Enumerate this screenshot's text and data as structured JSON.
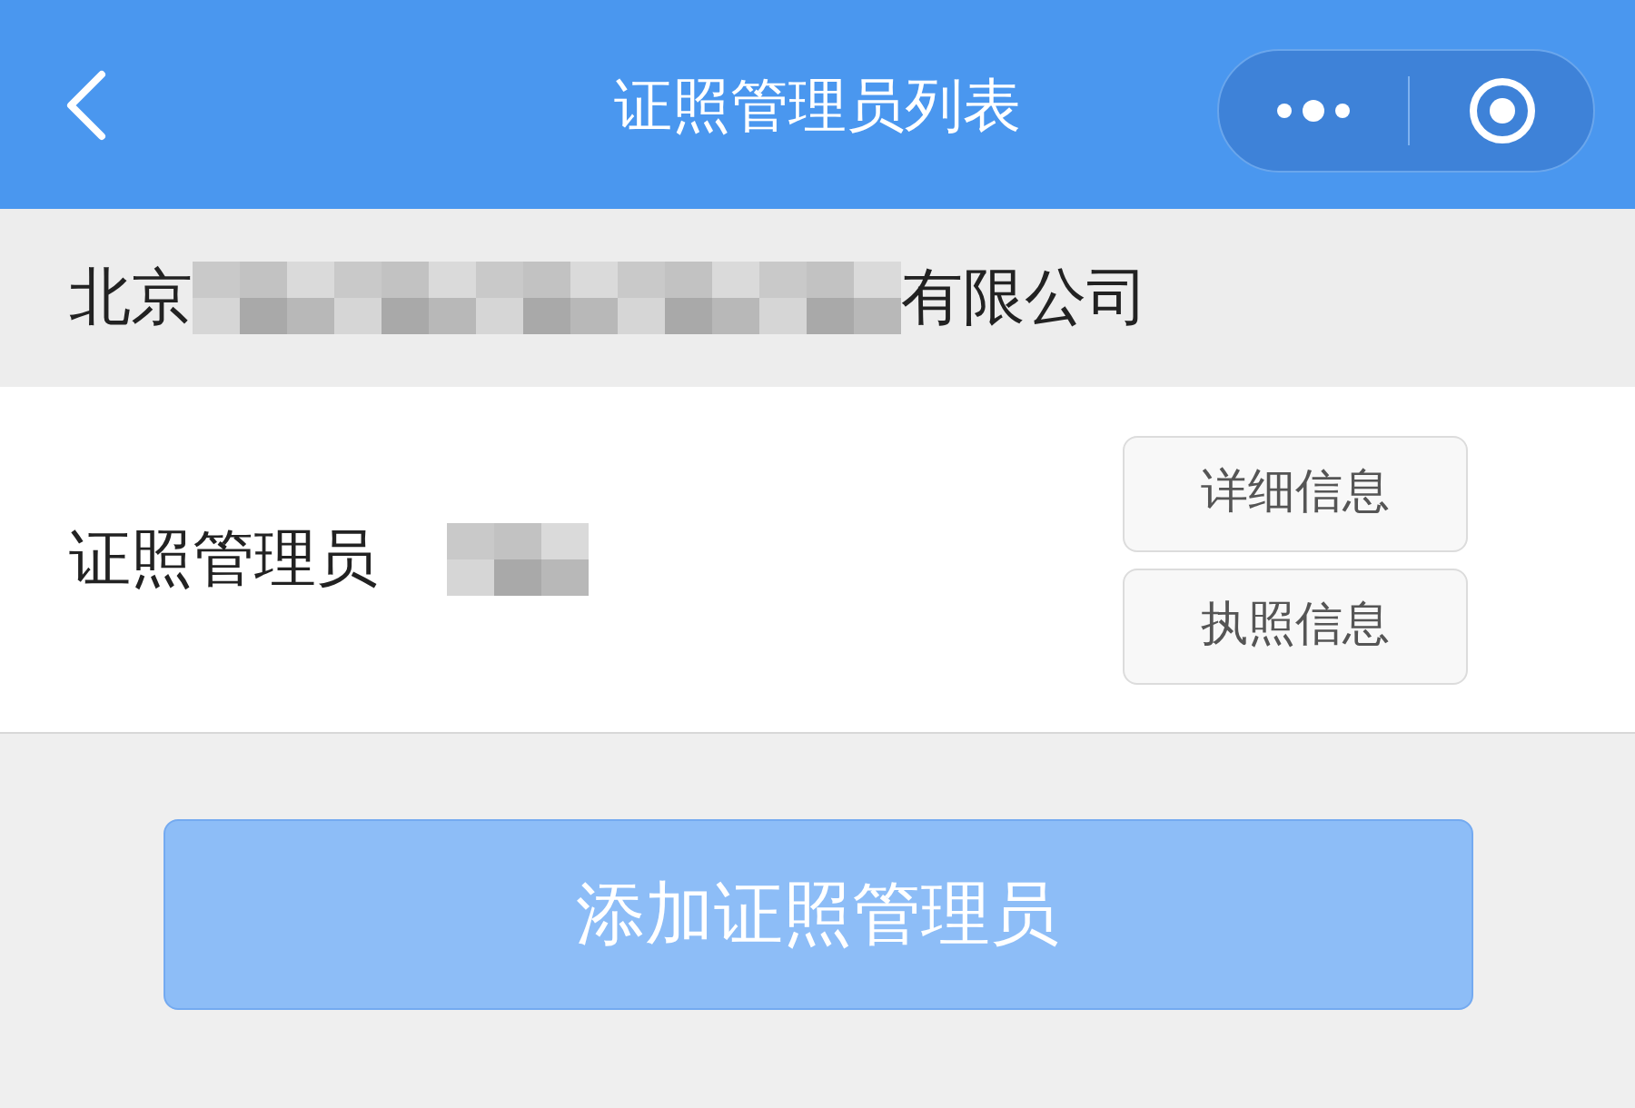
{
  "header": {
    "title": "证照管理员列表"
  },
  "company": {
    "prefix": "北京",
    "suffix": "有限公司",
    "redacted": true
  },
  "admin": {
    "label": "证照管理员",
    "redacted": true
  },
  "actions": [
    {
      "label": "详细信息"
    },
    {
      "label": "执照信息"
    }
  ],
  "add_button": {
    "label": "添加证照管理员",
    "disabled": true
  }
}
